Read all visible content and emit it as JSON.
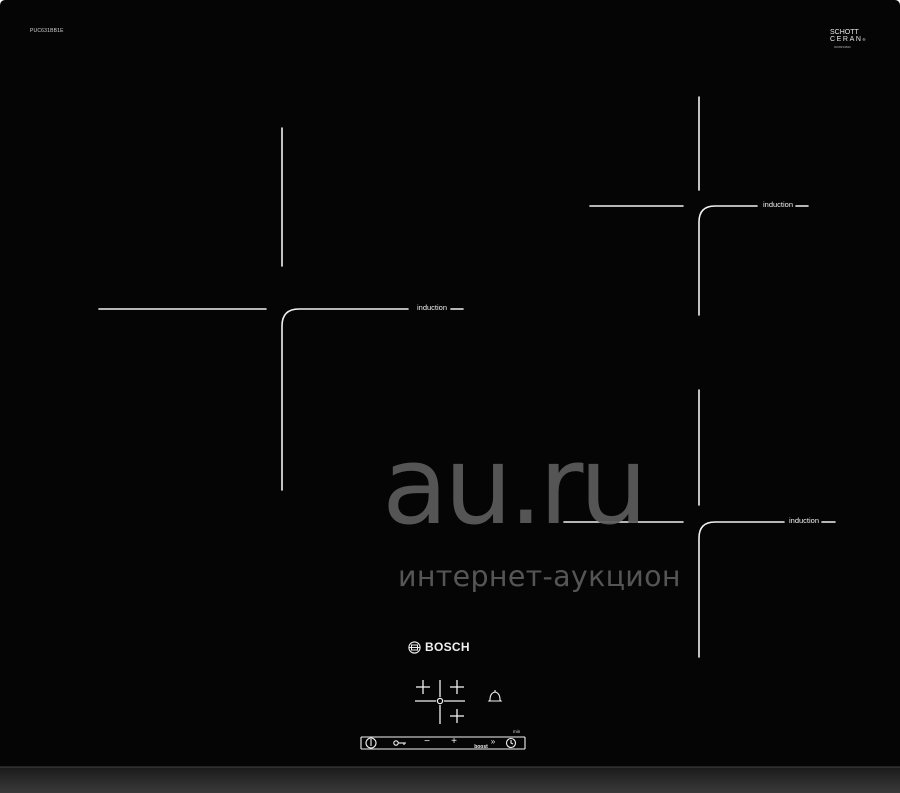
{
  "hob": {
    "model_number": "PUC631BB1E",
    "glass_brand": {
      "line1": "SCHOTT",
      "line2": "CERAN",
      "line3": "CERAN",
      "registered": "®",
      "sub": "0008934B2F"
    },
    "colors": {
      "glass": "#050505",
      "lines": "#f2f2f2",
      "edge": "#2a2a2a",
      "watermark": "#5c5c5c"
    }
  },
  "zones": [
    {
      "label": "induction"
    },
    {
      "label": "induction"
    },
    {
      "label": "induction"
    }
  ],
  "watermark": {
    "main": "au.ru",
    "sub": "интернет-аукцион"
  },
  "brand": {
    "logo_icon": "bosch-armature-icon",
    "name": "BOSCH"
  },
  "controls": {
    "min_label": "min",
    "zone_select_icon": "plus-icon",
    "timer_icon": "bell-icon",
    "center_icon": "timer-dot-icon",
    "strip": {
      "power_icon": "power-icon",
      "lock_icon": "key-lock-icon",
      "minus": "−",
      "plus": "+",
      "boost": "boost",
      "clock_icon": "clock-icon"
    }
  }
}
